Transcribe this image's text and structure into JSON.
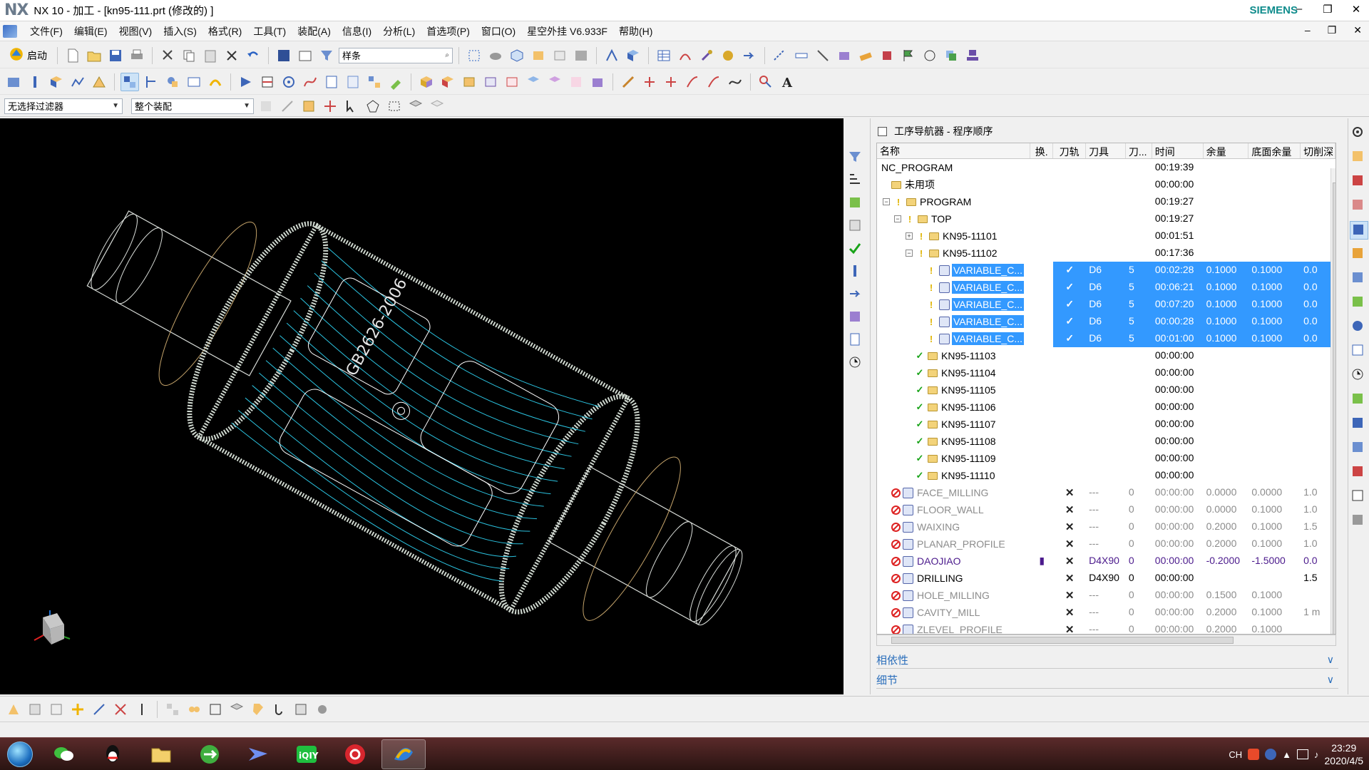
{
  "window": {
    "logo": "NX",
    "title": "NX 10 - 加工 - [kn95-111.prt  (修改的) ]",
    "brand": "SIEMENS",
    "minimize": "–",
    "restore": "❐",
    "close": "✕"
  },
  "menu": {
    "items": [
      "文件(F)",
      "编辑(E)",
      "视图(V)",
      "插入(S)",
      "格式(R)",
      "工具(T)",
      "装配(A)",
      "信息(I)",
      "分析(L)",
      "首选项(P)",
      "窗口(O)",
      "星空外挂 V6.933F",
      "帮助(H)"
    ]
  },
  "toolbar": {
    "start_label": "启动",
    "curve_rule": "样条",
    "selection_filter": "无选择过滤器",
    "assembly_scope": "整个装配"
  },
  "navigator": {
    "title": "工序导航器 - 程序顺序",
    "columns": [
      "名称",
      "换.",
      "刀轨",
      "刀具",
      "刀...",
      "时间",
      "余量",
      "底面余量",
      "切削深"
    ],
    "rows": [
      {
        "name": "NC_PROGRAM",
        "time": "00:19:39",
        "indent": 0,
        "kind": "root"
      },
      {
        "name": "未用项",
        "time": "00:00:00",
        "indent": 1,
        "kind": "folder"
      },
      {
        "name": "PROGRAM",
        "time": "00:19:27",
        "indent": 1,
        "kind": "group",
        "toggle": "−"
      },
      {
        "name": "TOP",
        "time": "00:19:27",
        "indent": 2,
        "kind": "group",
        "toggle": "−"
      },
      {
        "name": "KN95-11101",
        "time": "00:01:51",
        "indent": 3,
        "kind": "group",
        "toggle": "+"
      },
      {
        "name": "KN95-11102",
        "time": "00:17:36",
        "indent": 3,
        "kind": "group",
        "toggle": "−"
      },
      {
        "name": "VARIABLE_C...",
        "path": "✓",
        "tool": "D6",
        "tn": "5",
        "time": "00:02:28",
        "stock": "0.1000",
        "floor": "0.1000",
        "cut": "0.0",
        "indent": 4,
        "kind": "op",
        "sel": true
      },
      {
        "name": "VARIABLE_C...",
        "path": "✓",
        "tool": "D6",
        "tn": "5",
        "time": "00:06:21",
        "stock": "0.1000",
        "floor": "0.1000",
        "cut": "0.0",
        "indent": 4,
        "kind": "op",
        "sel": true
      },
      {
        "name": "VARIABLE_C...",
        "path": "✓",
        "tool": "D6",
        "tn": "5",
        "time": "00:07:20",
        "stock": "0.1000",
        "floor": "0.1000",
        "cut": "0.0",
        "indent": 4,
        "kind": "op",
        "sel": true
      },
      {
        "name": "VARIABLE_C...",
        "path": "✓",
        "tool": "D6",
        "tn": "5",
        "time": "00:00:28",
        "stock": "0.1000",
        "floor": "0.1000",
        "cut": "0.0",
        "indent": 4,
        "kind": "op",
        "sel": true
      },
      {
        "name": "VARIABLE_C...",
        "path": "✓",
        "tool": "D6",
        "tn": "5",
        "time": "00:01:00",
        "stock": "0.1000",
        "floor": "0.1000",
        "cut": "0.0",
        "indent": 4,
        "kind": "op",
        "sel": true
      },
      {
        "name": "KN95-11103",
        "time": "00:00:00",
        "indent": 3,
        "kind": "done"
      },
      {
        "name": "KN95-11104",
        "time": "00:00:00",
        "indent": 3,
        "kind": "done"
      },
      {
        "name": "KN95-11105",
        "time": "00:00:00",
        "indent": 3,
        "kind": "done"
      },
      {
        "name": "KN95-11106",
        "time": "00:00:00",
        "indent": 3,
        "kind": "done"
      },
      {
        "name": "KN95-11107",
        "time": "00:00:00",
        "indent": 3,
        "kind": "done"
      },
      {
        "name": "KN95-11108",
        "time": "00:00:00",
        "indent": 3,
        "kind": "done"
      },
      {
        "name": "KN95-11109",
        "time": "00:00:00",
        "indent": 3,
        "kind": "done"
      },
      {
        "name": "KN95-11110",
        "time": "00:00:00",
        "indent": 3,
        "kind": "done"
      },
      {
        "name": "FACE_MILLING",
        "path": "✕",
        "tool": "---",
        "tn": "0",
        "time": "00:00:00",
        "stock": "0.0000",
        "floor": "0.0000",
        "cut": "1.0",
        "indent": 1,
        "kind": "unused",
        "style": "grey"
      },
      {
        "name": "FLOOR_WALL",
        "path": "✕",
        "tool": "---",
        "tn": "0",
        "time": "00:00:00",
        "stock": "0.0000",
        "floor": "0.1000",
        "cut": "1.0",
        "indent": 1,
        "kind": "unused",
        "style": "grey"
      },
      {
        "name": "WAIXING",
        "path": "✕",
        "tool": "---",
        "tn": "0",
        "time": "00:00:00",
        "stock": "0.2000",
        "floor": "0.1000",
        "cut": "1.5",
        "indent": 1,
        "kind": "unused",
        "style": "grey"
      },
      {
        "name": "PLANAR_PROFILE",
        "path": "✕",
        "tool": "---",
        "tn": "0",
        "time": "00:00:00",
        "stock": "0.2000",
        "floor": "0.1000",
        "cut": "1.0",
        "indent": 1,
        "kind": "unused",
        "style": "grey"
      },
      {
        "name": "DAOJIAO",
        "swap": "▮",
        "path": "✕",
        "tool": "D4X90",
        "tn": "0",
        "time": "00:00:00",
        "stock": "-0.2000",
        "floor": "-1.5000",
        "cut": "0.0",
        "indent": 1,
        "kind": "unused",
        "style": "purple"
      },
      {
        "name": "DRILLING",
        "path": "✕",
        "tool": "D4X90",
        "tn": "0",
        "time": "00:00:00",
        "stock": "",
        "floor": "",
        "cut": "1.5",
        "indent": 1,
        "kind": "unused",
        "style": "normal"
      },
      {
        "name": "HOLE_MILLING",
        "path": "✕",
        "tool": "---",
        "tn": "0",
        "time": "00:00:00",
        "stock": "0.1500",
        "floor": "0.1000",
        "cut": "",
        "indent": 1,
        "kind": "unused",
        "style": "grey"
      },
      {
        "name": "CAVITY_MILL",
        "path": "✕",
        "tool": "---",
        "tn": "0",
        "time": "00:00:00",
        "stock": "0.2000",
        "floor": "0.1000",
        "cut": "1 m",
        "indent": 1,
        "kind": "unused",
        "style": "grey"
      },
      {
        "name": "ZLEVEL_PROFILE",
        "path": "✕",
        "tool": "---",
        "tn": "0",
        "time": "00:00:00",
        "stock": "0.2000",
        "floor": "0.1000",
        "cut": "",
        "indent": 1,
        "kind": "unused",
        "style": "grey"
      }
    ],
    "panels": [
      "相依性",
      "细节"
    ]
  },
  "taskbar": {
    "tray_lang": "CH",
    "time": "23:29",
    "date": "2020/4/5"
  },
  "colors": {
    "selection": "#3399ff",
    "brand": "#0f8c8c",
    "panel_text": "#2a6ebb",
    "toolpath": "#2bc3e0",
    "geometry": "#c8d6c8"
  }
}
